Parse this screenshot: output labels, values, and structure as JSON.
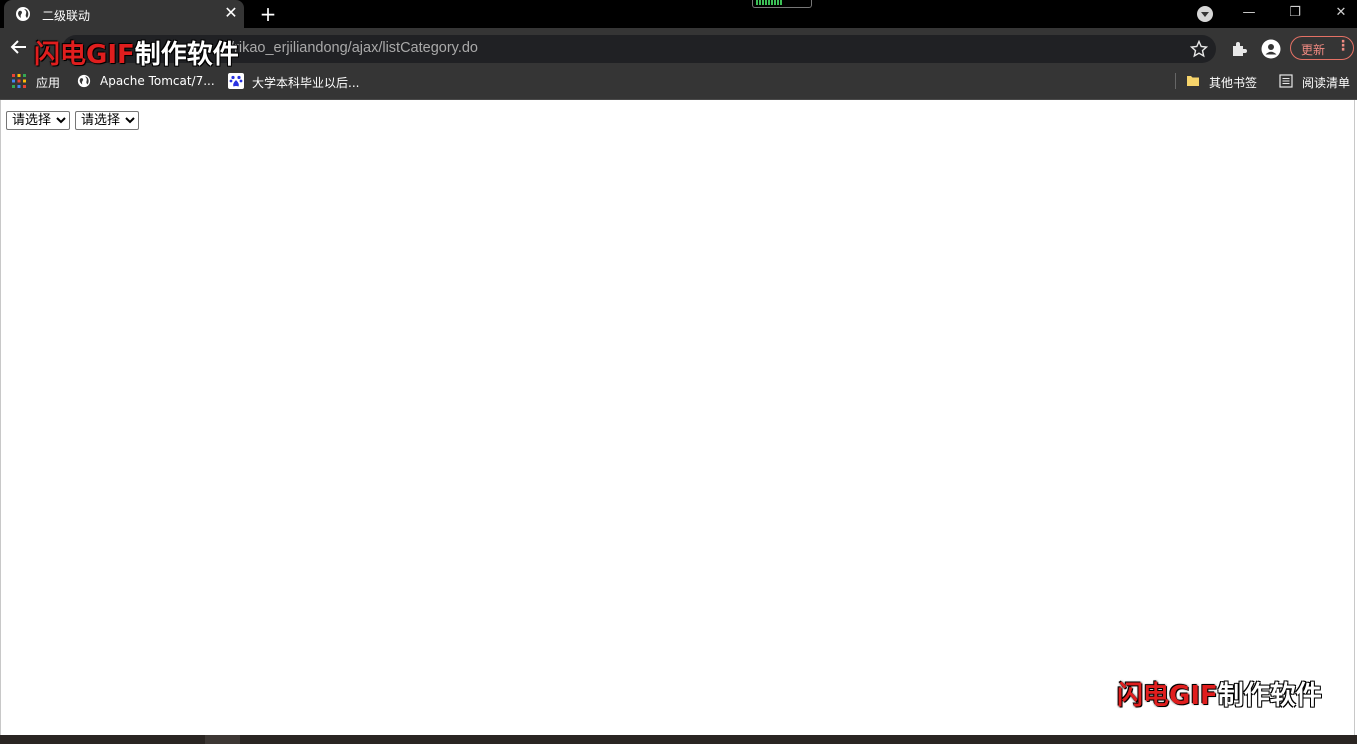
{
  "tab": {
    "title": "二级联动",
    "close": "✕",
    "new_tab": "+"
  },
  "window_controls": {
    "minimize": "—",
    "restore": "❐",
    "close": "✕"
  },
  "toolbar": {
    "url": "/rikao_erjiliandong/ajax/listCategory.do",
    "update_label": "更新",
    "menu_dots": "⋮"
  },
  "bookmarks": {
    "apps": "应用",
    "items": [
      {
        "label": "Apache Tomcat/7..."
      },
      {
        "label": "大学本科毕业以后..."
      }
    ],
    "other": "其他书签",
    "reading_list": "阅读清单"
  },
  "page": {
    "select1": {
      "selected": "请选择"
    },
    "select2": {
      "selected": "请选择"
    }
  },
  "watermark": {
    "red": "闪电GIF",
    "white": "制作软件"
  },
  "colors": {
    "chrome_dark": "#353535",
    "tab_strip": "#000000",
    "omnibox": "#202124",
    "update_accent": "#f28b82"
  }
}
